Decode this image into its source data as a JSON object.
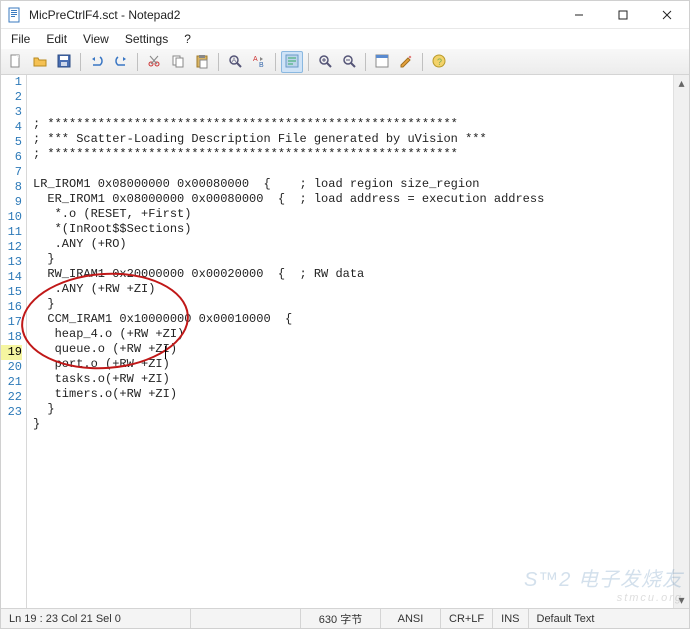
{
  "window": {
    "title": "MicPreCtrlF4.sct - Notepad2",
    "filename": "MicPreCtrlF4.sct",
    "app": "Notepad2"
  },
  "menu": [
    "File",
    "Edit",
    "View",
    "Settings",
    "?"
  ],
  "toolbar_icons": [
    "new-file",
    "open-file",
    "save-file",
    "sep",
    "undo",
    "redo",
    "sep",
    "cut",
    "copy",
    "paste",
    "sep",
    "find",
    "replace",
    "sep",
    "word-wrap",
    "sep",
    "zoom-in",
    "zoom-out",
    "sep",
    "scheme",
    "customize",
    "sep",
    "about"
  ],
  "lines": [
    "; *********************************************************",
    "; *** Scatter-Loading Description File generated by uVision ***",
    "; *********************************************************",
    "",
    "LR_IROM1 0x08000000 0x00080000  {    ; load region size_region",
    "  ER_IROM1 0x08000000 0x00080000  {  ; load address = execution address",
    "   *.o (RESET, +First)",
    "   *(InRoot$$Sections)",
    "   .ANY (+RO)",
    "  }",
    "  RW_IRAM1 0x20000000 0x00020000  {  ; RW data",
    "   .ANY (+RW +ZI)",
    "  }",
    "  CCM_IRAM1 0x10000000 0x00010000  {",
    "   heap_4.o (+RW +ZI)",
    "   queue.o (+RW +ZI)",
    "   port.o (+RW +ZI)",
    "   tasks.o(+RW +ZI)",
    "   timers.o(+RW +ZI)",
    "  }",
    "}",
    "",
    ""
  ],
  "current_line": 19,
  "status": {
    "pos": "Ln 19 : 23   Col 21   Sel 0",
    "size": "630 字节",
    "enc": "ANSI",
    "eol": "CR+LF",
    "ovr": "INS",
    "lexer": "Default Text"
  },
  "watermark": {
    "main": "S™2 电子发烧友",
    "sub": "stmcu.org"
  }
}
